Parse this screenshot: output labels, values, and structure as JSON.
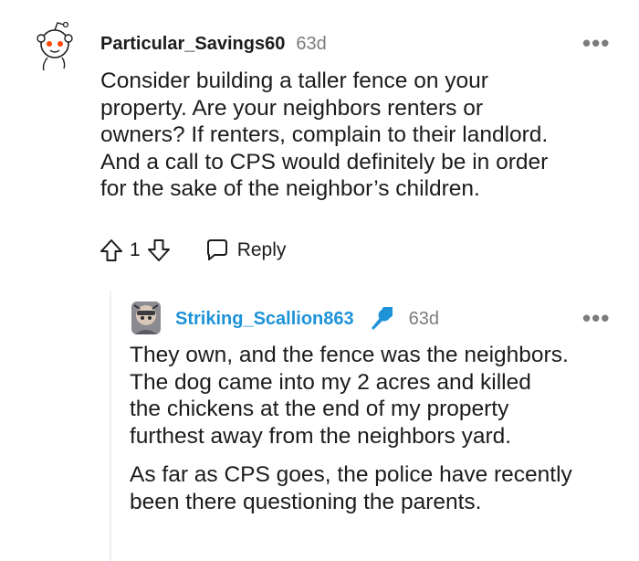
{
  "comments": [
    {
      "username": "Particular_Savings60",
      "time": "63d",
      "more": "•••",
      "body": [
        "Consider building a taller fence on your",
        "property. Are your neighbors renters or",
        "owners? If renters, complain to their landlord.",
        "And a call to CPS would definitely be in order",
        "for the sake of the neighbor’s children."
      ],
      "score": "1",
      "reply_label": "Reply"
    },
    {
      "username": "Striking_Scallion863",
      "time": "63d",
      "more": "•••",
      "paragraph1": [
        "They own, and the fence was the neighbors.",
        "The dog came into my 2 acres and killed",
        "the chickens at the end of my property",
        "furthest away from the neighbors yard."
      ],
      "paragraph2": [
        "As far as CPS goes, the police have recently",
        "been there questioning the parents."
      ]
    }
  ],
  "colors": {
    "reply_username": "#1f93d8",
    "mic": "#1f93d8",
    "muted": "#7c7c7c"
  }
}
